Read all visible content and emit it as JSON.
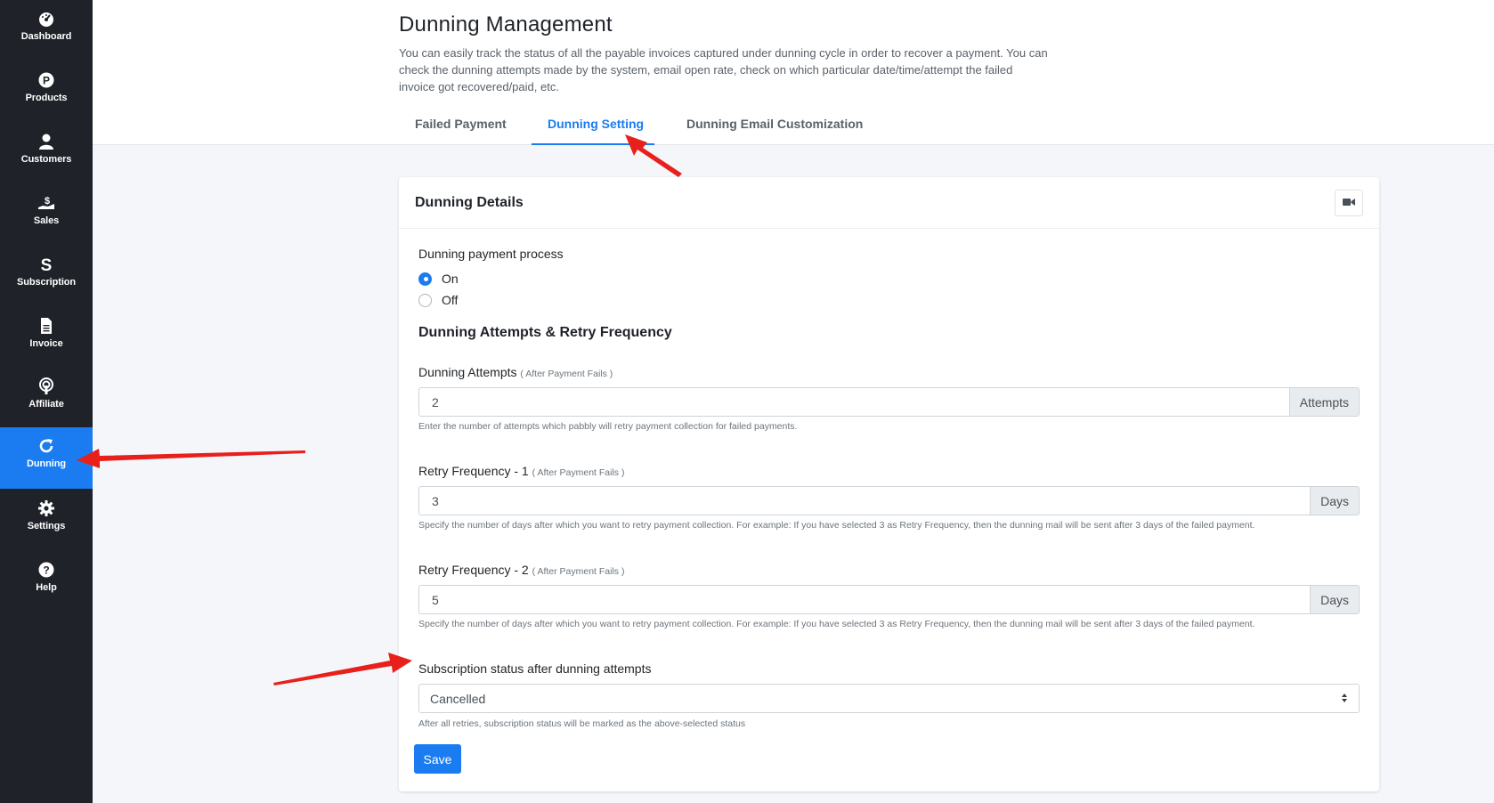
{
  "sidebar": {
    "items": [
      {
        "label": "Dashboard",
        "icon": "dashboard-icon"
      },
      {
        "label": "Products",
        "icon": "products-icon"
      },
      {
        "label": "Customers",
        "icon": "customers-icon"
      },
      {
        "label": "Sales",
        "icon": "sales-icon"
      },
      {
        "label": "Subscription",
        "icon": "subscription-icon"
      },
      {
        "label": "Invoice",
        "icon": "invoice-icon"
      },
      {
        "label": "Affiliate",
        "icon": "affiliate-icon"
      },
      {
        "label": "Dunning",
        "icon": "dunning-icon"
      },
      {
        "label": "Settings",
        "icon": "gear-icon"
      },
      {
        "label": "Help",
        "icon": "help-icon"
      }
    ],
    "active_item": "Dunning",
    "colors": {
      "background": "#1f2228",
      "active": "#1a7cf0"
    }
  },
  "header": {
    "title": "Dunning Management",
    "description": "You can easily track the status of all the payable invoices captured under dunning cycle in order to recover a payment. You can check the dunning attempts made by the system, email open rate, check on which particular date/time/attempt the failed invoice got recovered/paid, etc.",
    "tabs": [
      {
        "label": "Failed Payment",
        "active": false
      },
      {
        "label": "Dunning Setting",
        "active": true
      },
      {
        "label": "Dunning Email Customization",
        "active": false
      }
    ]
  },
  "card": {
    "title": "Dunning Details",
    "video_button_icon": "video-camera-icon",
    "payment_process": {
      "label": "Dunning payment process",
      "options": [
        {
          "label": "On",
          "checked": true
        },
        {
          "label": "Off",
          "checked": false
        }
      ]
    },
    "section_title": "Dunning Attempts & Retry Frequency",
    "attempts": {
      "label": "Dunning Attempts",
      "hint": "( After Payment Fails )",
      "value": "2",
      "addon": "Attempts",
      "help": "Enter the number of attempts which pabbly will retry payment collection for failed payments."
    },
    "retry1": {
      "label": "Retry Frequency - 1",
      "hint": "( After Payment Fails )",
      "value": "3",
      "addon": "Days",
      "help": "Specify the number of days after which you want to retry payment collection. For example: If you have selected 3 as Retry Frequency, then the dunning mail will be sent after 3 days of the failed payment."
    },
    "retry2": {
      "label": "Retry Frequency - 2",
      "hint": "( After Payment Fails )",
      "value": "5",
      "addon": "Days",
      "help": "Specify the number of days after which you want to retry payment collection. For example: If you have selected 3 as Retry Frequency, then the dunning mail will be sent after 3 days of the failed payment."
    },
    "status": {
      "label": "Subscription status after dunning attempts",
      "selected": "Cancelled",
      "help": "After all retries, subscription status will be marked as the above-selected status"
    },
    "save_label": "Save"
  },
  "annotation_color": "#e8201c"
}
